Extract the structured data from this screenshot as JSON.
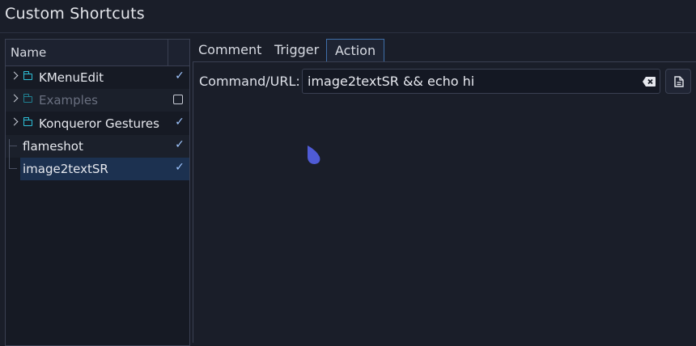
{
  "window": {
    "title": "Custom Shortcuts"
  },
  "tree": {
    "header": "Name",
    "items": [
      {
        "label": "KMenuEdit",
        "checked": true,
        "enabled": true,
        "folder": true
      },
      {
        "label": "Examples",
        "checked": false,
        "enabled": false,
        "folder": true
      },
      {
        "label": "Konqueror Gestures",
        "checked": true,
        "enabled": true,
        "folder": true
      },
      {
        "label": "flameshot",
        "checked": true,
        "enabled": true,
        "folder": false
      },
      {
        "label": "image2textSR",
        "checked": true,
        "enabled": true,
        "folder": false,
        "selected": true
      }
    ]
  },
  "tabs": [
    {
      "label": "Comment"
    },
    {
      "label": "Trigger"
    },
    {
      "label": "Action"
    }
  ],
  "action": {
    "command_label": "Command/URL:",
    "command_value": "image2textSR && echo hi"
  },
  "colors": {
    "background": "#1a1e29",
    "selection": "#1c3150",
    "folder_icon": "#2ec0d8",
    "check": "#9fc6ff",
    "cursor": "#4f5bd5"
  }
}
